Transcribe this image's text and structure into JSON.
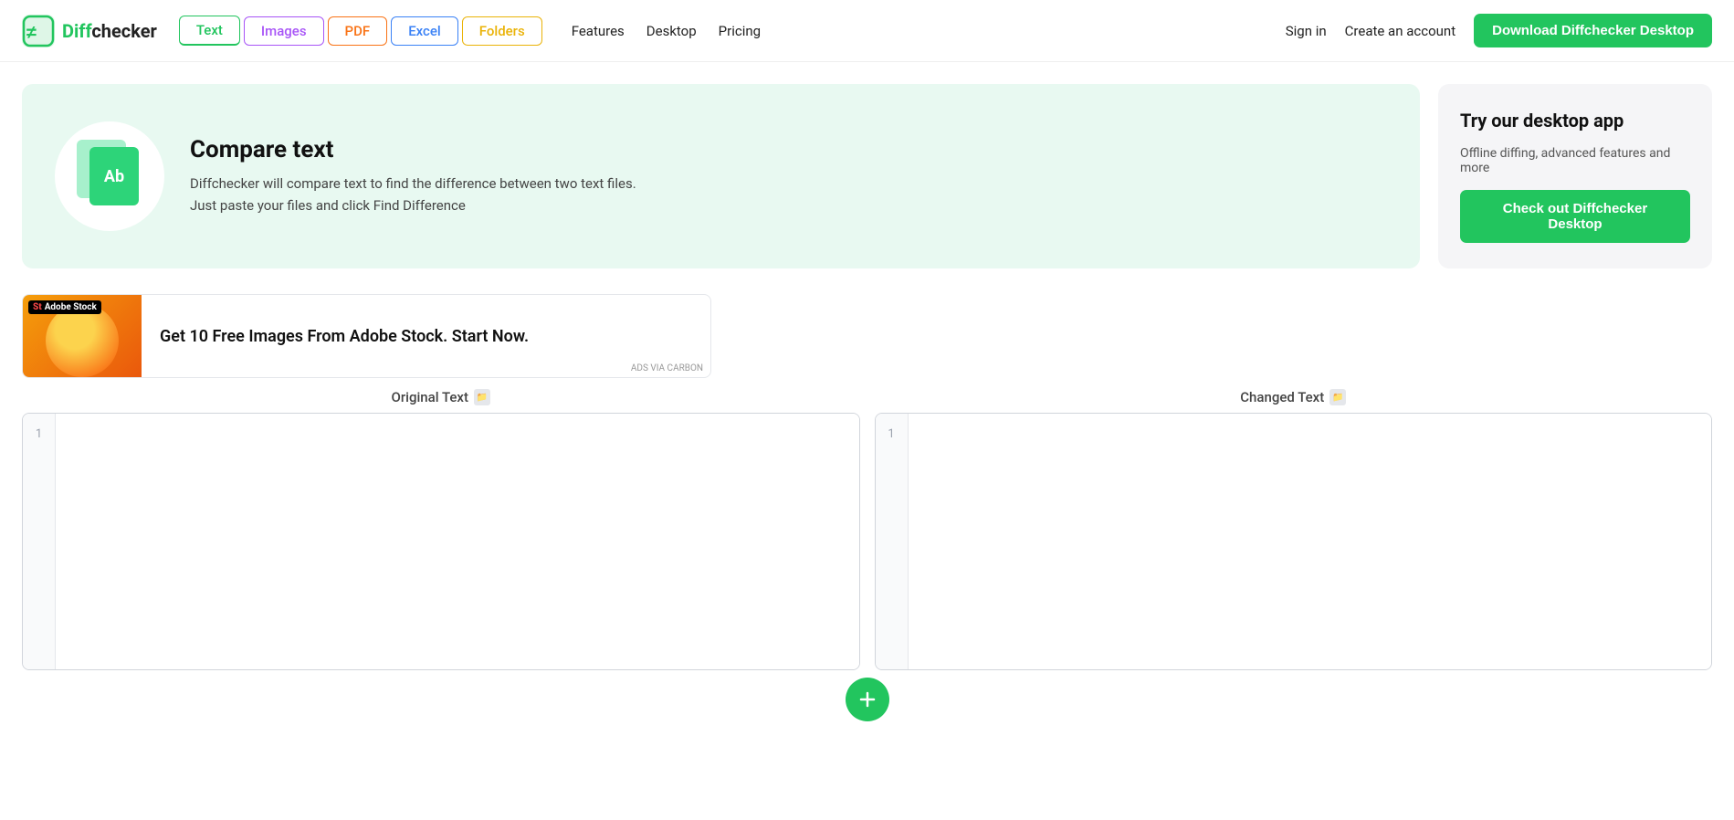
{
  "brand": {
    "name_prefix": "Diff",
    "name_suffix": "checker",
    "logo_alt": "Diffchecker logo"
  },
  "nav": {
    "tabs": [
      {
        "id": "text",
        "label": "Text",
        "class": "text"
      },
      {
        "id": "images",
        "label": "Images",
        "class": "images"
      },
      {
        "id": "pdf",
        "label": "PDF",
        "class": "pdf"
      },
      {
        "id": "excel",
        "label": "Excel",
        "class": "excel"
      },
      {
        "id": "folders",
        "label": "Folders",
        "class": "folders"
      }
    ],
    "links": [
      {
        "id": "features",
        "label": "Features"
      },
      {
        "id": "desktop",
        "label": "Desktop"
      },
      {
        "id": "pricing",
        "label": "Pricing"
      }
    ],
    "signin": "Sign in",
    "create_account": "Create an account",
    "download_btn": "Download Diffchecker Desktop"
  },
  "hero": {
    "title": "Compare text",
    "description_line1": "Diffchecker will compare text to find the difference between two text files.",
    "description_line2": "Just paste your files and click Find Difference",
    "file_label1": "Ab",
    "file_label2": "Ab"
  },
  "sidebar": {
    "title": "Try our desktop app",
    "description": "Offline diffing, advanced features and more",
    "btn_label": "Check out Diffchecker Desktop"
  },
  "ad": {
    "brand_label": "St Adobe Stock",
    "text": "Get 10 Free Images From Adobe Stock. Start Now.",
    "footer": "ADS VIA CARBON"
  },
  "diff": {
    "original_label": "Original Text",
    "changed_label": "Changed Text",
    "upload_icon_title": "Upload file",
    "original_line_numbers": [
      "1"
    ],
    "changed_line_numbers": [
      "1"
    ],
    "original_placeholder": "",
    "changed_placeholder": "",
    "find_diff_title": "Find Difference"
  }
}
